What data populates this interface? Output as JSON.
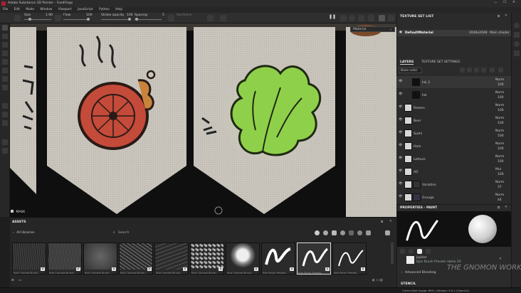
{
  "window": {
    "title": "Adobe Substance 3D Painter - FoodFlags"
  },
  "menu": [
    "File",
    "Edit",
    "Mode",
    "Window",
    "Viewport",
    "JavaScript",
    "Python",
    "Help"
  ],
  "toolbar": {
    "size_label": "Size",
    "size_value": "1.90",
    "flow_label": "Flow",
    "flow_value": "100",
    "stroke_opacity_label": "Stroke opacity",
    "stroke_opacity_value": "100",
    "spacing_label": "Spacing",
    "spacing_value": "5",
    "hardness_label": "Hardness"
  },
  "viewport": {
    "material_dropdown": "Material",
    "mask_label": "MASK"
  },
  "texture_set_list": {
    "title": "TEXTURE SET LIST",
    "set_name": "DefaultMaterial",
    "resolution": "2048x2048",
    "shader": "Main shader"
  },
  "layers_panel": {
    "tab_layers": "LAYERS",
    "tab_settings": "TEXTURE SET SETTINGS",
    "blend_dropdown": "Base color",
    "layers": [
      {
        "name": "Ink 2",
        "blend": "Norm",
        "opacity": "100"
      },
      {
        "name": "Ink",
        "blend": "Norm",
        "opacity": "100"
      },
      {
        "name": "Ramen",
        "blend": "Norm",
        "opacity": "100"
      },
      {
        "name": "Beer",
        "blend": "Norm",
        "opacity": "100"
      },
      {
        "name": "Sushi",
        "blend": "Norm",
        "opacity": "100"
      },
      {
        "name": "Ham",
        "blend": "Norm",
        "opacity": "100"
      },
      {
        "name": "Lettuce",
        "blend": "Norm",
        "opacity": "100"
      },
      {
        "name": "AO",
        "blend": "Mul",
        "opacity": "100"
      },
      {
        "name": "Variation",
        "blend": "Norm",
        "opacity": "37"
      },
      {
        "name": "Grunge",
        "blend": "Norm",
        "opacity": "44"
      }
    ]
  },
  "properties": {
    "title": "PROPERTIES - PAINT",
    "brush_name": "Jupiter",
    "brush_desc": "Kyle Brush Presets alpha 24",
    "advanced_blending": "Advanced Blending",
    "stencil": "STENCIL"
  },
  "assets": {
    "title": "ASSETS",
    "library": "All libraries",
    "search_placeholder": "Search",
    "items": [
      {
        "caption": "Kyle Concept Brush..."
      },
      {
        "caption": "Kyle Concept Brush..."
      },
      {
        "caption": "Kyle Concept Brush..."
      },
      {
        "caption": "Kyle Concept Brush..."
      },
      {
        "caption": "Kyle Concept Brush..."
      },
      {
        "caption": "Kyle Concept Brush..."
      },
      {
        "caption": "Kyle Concept Brush..."
      },
      {
        "caption": "Kyle Brush Presets..."
      },
      {
        "caption": "Kyle Brush Presets..."
      },
      {
        "caption": "Kyle Brush Presets..."
      }
    ]
  },
  "statusbar": {
    "cache_text": "Cache Disk Usage:  89% | Version: 9.0.1 (OpenGL)"
  },
  "watermark": "THE GNOMON WORKSHOP"
}
